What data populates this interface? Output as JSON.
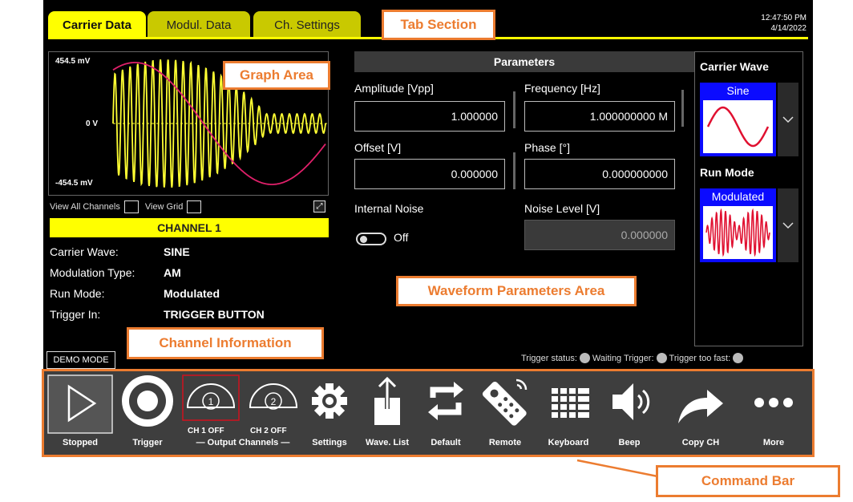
{
  "tabs": [
    {
      "label": "Carrier Data",
      "active": true
    },
    {
      "label": "Modul. Data",
      "active": false
    },
    {
      "label": "Ch. Settings",
      "active": false
    }
  ],
  "datetime": {
    "time": "12:47:50 PM",
    "date": "4/14/2022"
  },
  "graph": {
    "y_max_label": "454.5 mV",
    "y_zero_label": "0 V",
    "y_min_label": "-454.5 mV",
    "view_all_channels_label": "View All Channels",
    "view_grid_label": "View Grid",
    "colors": {
      "signal": "#ffff33",
      "envelope": "#e0206a"
    }
  },
  "channel_info": {
    "header": "CHANNEL 1",
    "rows": [
      {
        "key": "Carrier Wave:",
        "value": "SINE"
      },
      {
        "key": "Modulation Type:",
        "value": "AM"
      },
      {
        "key": "Run Mode:",
        "value": "Modulated"
      },
      {
        "key": "Trigger In:",
        "value": "TRIGGER BUTTON"
      }
    ],
    "demo_mode": "DEMO MODE"
  },
  "parameters": {
    "title": "Parameters",
    "amplitude": {
      "label": "Amplitude [Vpp]",
      "value": "1.000000"
    },
    "frequency": {
      "label": "Frequency [Hz]",
      "value": "1.000000000 M"
    },
    "offset": {
      "label": "Offset [V]",
      "value": "0.000000"
    },
    "phase": {
      "label": "Phase [°]",
      "value": "0.000000000"
    },
    "internal_noise": {
      "label": "Internal Noise",
      "toggle": "Off"
    },
    "noise_level": {
      "label": "Noise Level [V]",
      "value": "0.000000"
    }
  },
  "right_panel": {
    "carrier_wave_title": "Carrier Wave",
    "carrier_wave_value": "Sine",
    "run_mode_title": "Run Mode",
    "run_mode_value": "Modulated"
  },
  "trigger_status": {
    "status": "Trigger status:",
    "waiting": "Waiting Trigger:",
    "too_fast": "Trigger too fast:"
  },
  "command_bar": {
    "stopped": "Stopped",
    "trigger": "Trigger",
    "output_channels": "— Output Channels —",
    "ch1": "CH 1 OFF",
    "ch2": "CH 2 OFF",
    "settings": "Settings",
    "wave_list": "Wave. List",
    "default": "Default",
    "remote": "Remote",
    "keyboard": "Keyboard",
    "beep": "Beep",
    "copy_ch": "Copy CH",
    "more": "More"
  },
  "callouts": {
    "tab_section": "Tab Section",
    "graph_area": "Graph Area",
    "waveform_parameters_area": "Waveform Parameters Area",
    "channel_information": "Channel Information",
    "command_bar": "Command Bar"
  }
}
